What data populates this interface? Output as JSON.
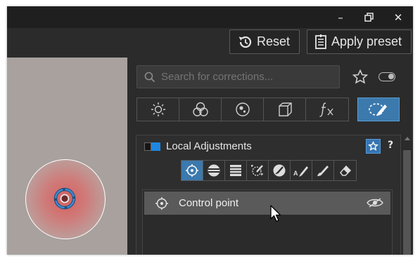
{
  "window": {
    "minimize_glyph": "–",
    "maximize_glyph": "🗗",
    "close_glyph": "✕"
  },
  "toolbar": {
    "reset_label": "Reset",
    "apply_preset_label": "Apply preset"
  },
  "search": {
    "placeholder": "Search for corrections...",
    "value": ""
  },
  "category_tabs": [
    {
      "icon": "sun-icon",
      "active": false
    },
    {
      "icon": "color-circles-icon",
      "active": false
    },
    {
      "icon": "lens-icon",
      "active": false
    },
    {
      "icon": "perspective-cube-icon",
      "active": false
    },
    {
      "icon": "fx-icon",
      "active": false
    },
    {
      "icon": "local-brush-icon",
      "active": true
    }
  ],
  "local_adjustments": {
    "title": "Local Adjustments",
    "help_label": "?",
    "accent_color": "#1f87e0",
    "tools": [
      {
        "icon": "control-point-icon",
        "active": true
      },
      {
        "icon": "graduated-filter-icon",
        "active": false
      },
      {
        "icon": "linear-gradient-icon",
        "active": false
      },
      {
        "icon": "auto-mask-icon",
        "active": false
      },
      {
        "icon": "eyedropper-mask-icon",
        "active": false
      },
      {
        "icon": "auto-brush-icon",
        "active": false
      },
      {
        "icon": "brush-icon",
        "active": false
      },
      {
        "icon": "eraser-icon",
        "active": false
      }
    ],
    "items": [
      {
        "label": "Control point",
        "icon": "control-point-icon",
        "visible": true
      }
    ]
  },
  "colors": {
    "active_blue": "#3c79ad",
    "background": "#2b2b2b"
  }
}
